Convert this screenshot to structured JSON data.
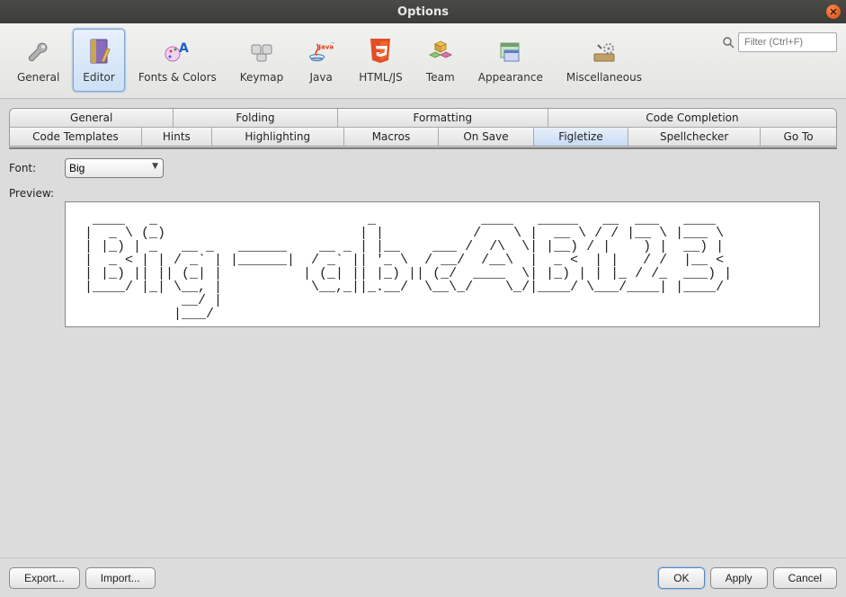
{
  "window": {
    "title": "Options"
  },
  "search": {
    "placeholder": "Filter (Ctrl+F)"
  },
  "toolbar": {
    "items": [
      {
        "label": "General"
      },
      {
        "label": "Editor"
      },
      {
        "label": "Fonts & Colors"
      },
      {
        "label": "Keymap"
      },
      {
        "label": "Java"
      },
      {
        "label": "HTML/JS"
      },
      {
        "label": "Team"
      },
      {
        "label": "Appearance"
      },
      {
        "label": "Miscellaneous"
      }
    ],
    "selected": "Editor"
  },
  "tabs": {
    "row1": [
      "General",
      "Folding",
      "Formatting",
      "Code Completion"
    ],
    "row2": [
      "Code Templates",
      "Hints",
      "Highlighting",
      "Macros",
      "On Save",
      "Figletize",
      "Spellchecker",
      "Go To"
    ],
    "active": "Figletize"
  },
  "form": {
    "font_label": "Font:",
    "preview_label": "Preview:",
    "font_value": "Big",
    "font_options": [
      "Big"
    ]
  },
  "preview": {
    "ascii": "  ____   _                          _             ____   _____   __  ___   ____  \n |  _ \\ (_)                        | |           /    \\ |  __ \\ / / |__ \\ |___ \\ \n | |_) | _   __ _   ______    __ _ | |__    ___ /  /\\  \\| |__) / |    ) |  __) |\n |  _ < | | / _` | |______|  / _` || '_ \\  / __/  /__\\  |  _ <  | |   / /  |__ < \n | |_) || || (_| |          | (_| || |_) || (_/  ____  \\| |_) | | |_ / /_  ___) |\n |____/ |_| \\__, |           \\__,_||_.__/  \\__\\_/    \\_/|____/ \\___/____| |____/ \n             __/ |                                                               \n            |___/                                                                "
  },
  "buttons": {
    "export": "Export...",
    "import": "Import...",
    "ok": "OK",
    "apply": "Apply",
    "cancel": "Cancel"
  }
}
